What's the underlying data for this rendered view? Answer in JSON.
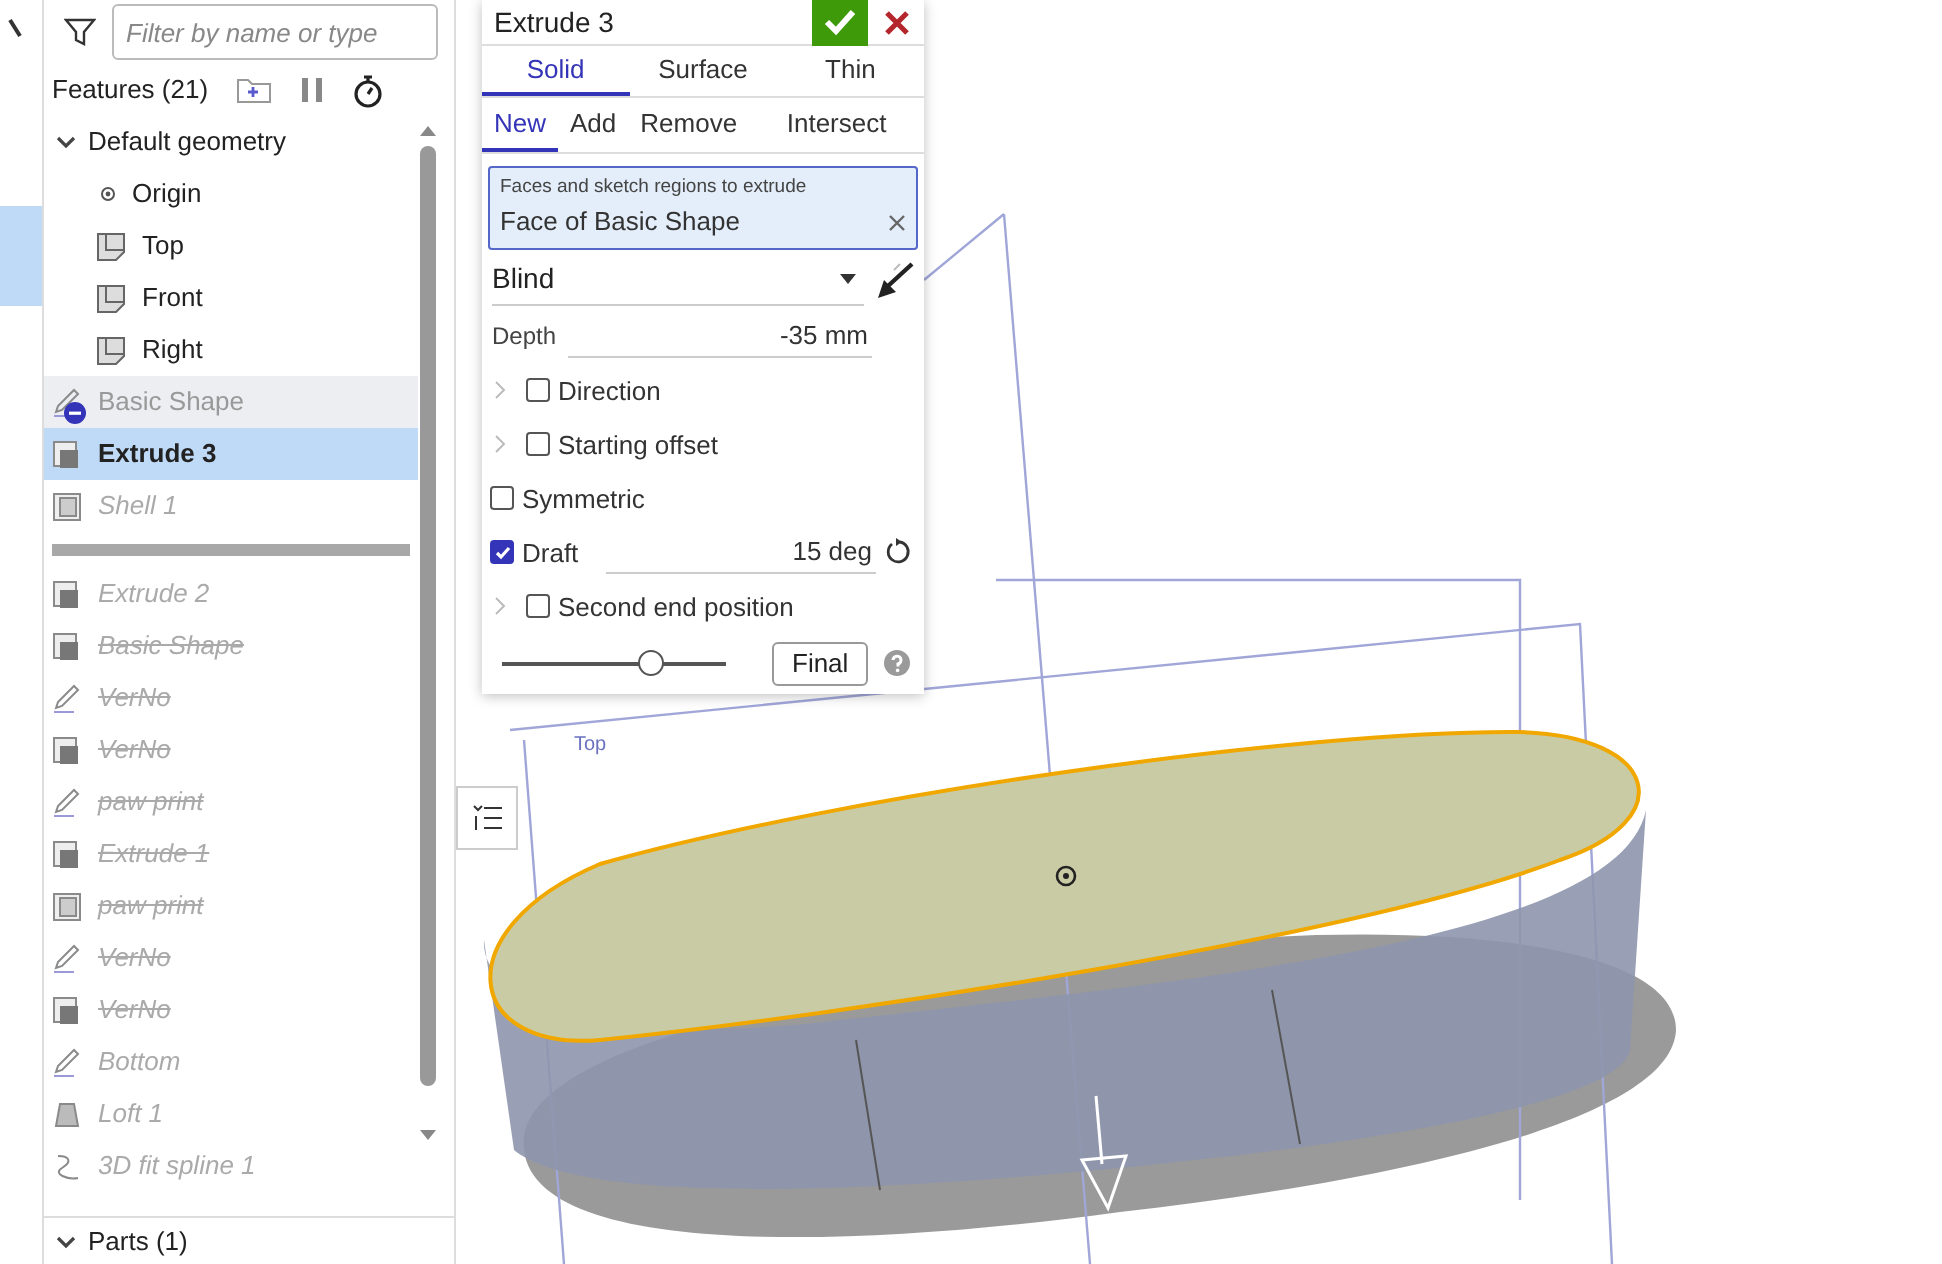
{
  "filter": {
    "placeholder": "Filter by name or type"
  },
  "features_title": "Features (21)",
  "default_geometry": {
    "label": "Default geometry",
    "expanded": true,
    "children": [
      {
        "label": "Origin",
        "kind": "origin"
      },
      {
        "label": "Top",
        "kind": "plane"
      },
      {
        "label": "Front",
        "kind": "plane"
      },
      {
        "label": "Right",
        "kind": "plane"
      }
    ]
  },
  "features": [
    {
      "label": "Basic Shape",
      "kind": "sketch",
      "consumed": true,
      "rolled_back": false,
      "suppressed": false,
      "selected": false
    },
    {
      "label": "Extrude 3",
      "kind": "extrude",
      "consumed": false,
      "rolled_back": false,
      "suppressed": false,
      "selected": true
    },
    {
      "label": "Shell 1",
      "kind": "shell",
      "consumed": false,
      "rolled_back": true,
      "suppressed": false,
      "selected": false
    },
    {
      "kind": "rollback_bar"
    },
    {
      "label": "Extrude 2",
      "kind": "extrude",
      "consumed": false,
      "rolled_back": true,
      "suppressed": false,
      "selected": false
    },
    {
      "label": "Basic Shape",
      "kind": "extrude",
      "consumed": false,
      "rolled_back": true,
      "suppressed": true,
      "selected": false
    },
    {
      "label": "VerNo",
      "kind": "sketch",
      "consumed": false,
      "rolled_back": true,
      "suppressed": true,
      "selected": false
    },
    {
      "label": "VerNo",
      "kind": "extrude",
      "consumed": false,
      "rolled_back": true,
      "suppressed": true,
      "selected": false
    },
    {
      "label": "paw print",
      "kind": "sketch",
      "consumed": false,
      "rolled_back": true,
      "suppressed": true,
      "selected": false
    },
    {
      "label": "Extrude 1",
      "kind": "extrude",
      "consumed": false,
      "rolled_back": true,
      "suppressed": true,
      "selected": false
    },
    {
      "label": "paw print",
      "kind": "shell",
      "consumed": false,
      "rolled_back": true,
      "suppressed": true,
      "selected": false
    },
    {
      "label": "VerNo",
      "kind": "sketch",
      "consumed": false,
      "rolled_back": true,
      "suppressed": true,
      "selected": false
    },
    {
      "label": "VerNo",
      "kind": "extrude",
      "consumed": false,
      "rolled_back": true,
      "suppressed": true,
      "selected": false
    },
    {
      "label": "Bottom",
      "kind": "sketch",
      "consumed": false,
      "rolled_back": true,
      "suppressed": false,
      "selected": false
    },
    {
      "label": "Loft 1",
      "kind": "loft",
      "consumed": false,
      "rolled_back": true,
      "suppressed": false,
      "selected": false
    },
    {
      "label": "3D fit spline 1",
      "kind": "spline",
      "consumed": false,
      "rolled_back": true,
      "suppressed": false,
      "selected": false
    }
  ],
  "parts": {
    "label": "Parts (1)",
    "expanded": true
  },
  "dialog": {
    "title": "Extrude 3",
    "type_tabs": [
      {
        "label": "Solid",
        "selected": true
      },
      {
        "label": "Surface",
        "selected": false
      },
      {
        "label": "Thin",
        "selected": false
      }
    ],
    "operation_tabs": [
      {
        "label": "New",
        "selected": true
      },
      {
        "label": "Add",
        "selected": false
      },
      {
        "label": "Remove",
        "selected": false
      },
      {
        "label": "Intersect",
        "selected": false
      }
    ],
    "selection": {
      "label": "Faces and sketch regions to extrude",
      "value": "Face of Basic Shape"
    },
    "end_type": "Blind",
    "depth": {
      "label": "Depth",
      "value": "-35 mm"
    },
    "options": [
      {
        "kind": "expandable",
        "label": "Direction",
        "checked": false
      },
      {
        "kind": "expandable",
        "label": "Starting offset",
        "checked": false
      },
      {
        "kind": "checkbox",
        "label": "Symmetric",
        "checked": false
      },
      {
        "kind": "value",
        "label": "Draft",
        "checked": true,
        "value": "15 deg"
      },
      {
        "kind": "expandable",
        "label": "Second end position",
        "checked": false
      }
    ],
    "slider": {
      "level": 0.68
    },
    "final_button": "Final"
  },
  "viewport": {
    "plane_label": "Top"
  }
}
